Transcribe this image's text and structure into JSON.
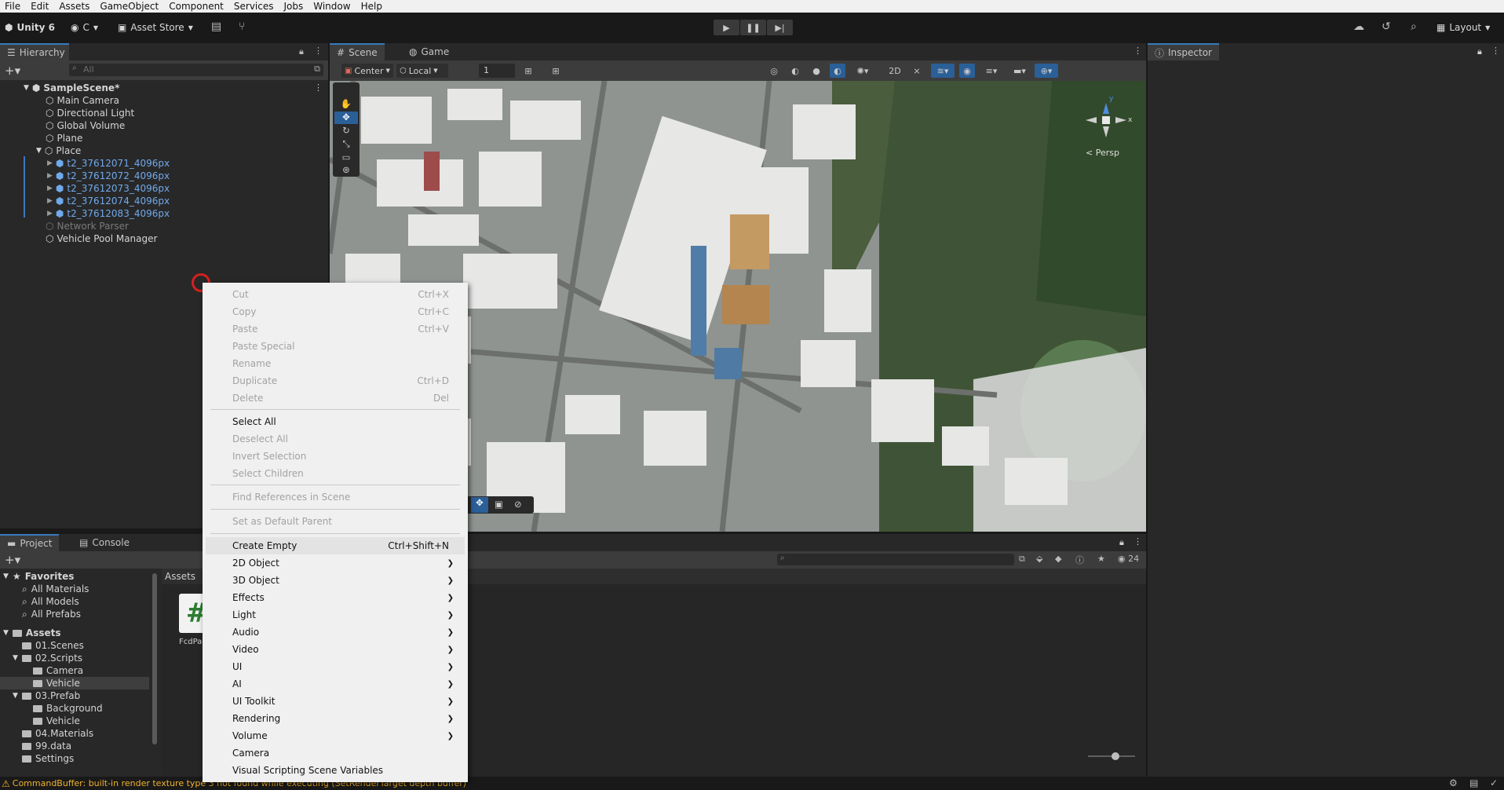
{
  "menubar": {
    "items": [
      "File",
      "Edit",
      "Assets",
      "GameObject",
      "Component",
      "Services",
      "Jobs",
      "Window",
      "Help"
    ]
  },
  "toolbar": {
    "unity": "Unity 6",
    "account": "C",
    "asset_store": "Asset Store",
    "layout": "Layout"
  },
  "hierarchy": {
    "tab": "Hierarchy",
    "search_placeholder": "All",
    "scene": "SampleScene*",
    "items": [
      "Main Camera",
      "Directional Light",
      "Global Volume",
      "Plane",
      "Place"
    ],
    "place_children": [
      "t2_37612071_4096px",
      "t2_37612072_4096px",
      "t2_37612073_4096px",
      "t2_37612074_4096px",
      "t2_37612083_4096px"
    ],
    "after": [
      "Network Parser",
      "Vehicle Pool Manager"
    ]
  },
  "scene": {
    "tabs": [
      "Scene",
      "Game"
    ],
    "pivot": "Center",
    "space": "Local",
    "snap": "1",
    "persp": "< Persp",
    "gizmo_x": "x",
    "gizmo_y": "y"
  },
  "inspector": {
    "tab": "Inspector"
  },
  "project": {
    "tabs": [
      "Project",
      "Console"
    ],
    "favorites": "Favorites",
    "fav_items": [
      "All Materials",
      "All Models",
      "All Prefabs"
    ],
    "assets": "Assets",
    "tree": [
      {
        "label": "01.Scenes",
        "indent": 1
      },
      {
        "label": "02.Scripts",
        "indent": 1
      },
      {
        "label": "Camera",
        "indent": 2
      },
      {
        "label": "Vehicle",
        "indent": 2
      },
      {
        "label": "03.Prefab",
        "indent": 1
      },
      {
        "label": "Background",
        "indent": 2
      },
      {
        "label": "Vehicle",
        "indent": 2
      },
      {
        "label": "04.Materials",
        "indent": 1
      },
      {
        "label": "99.data",
        "indent": 1
      },
      {
        "label": "Settings",
        "indent": 1
      }
    ],
    "breadcrumb": "Assets",
    "asset_name": "FcdPa",
    "count": "24"
  },
  "status": {
    "message": "CommandBuffer: built-in render texture type 3 not found while executing (SetRenderTarget depth buffer)"
  },
  "context_menu": {
    "group1": [
      {
        "label": "Cut",
        "shortcut": "Ctrl+X"
      },
      {
        "label": "Copy",
        "shortcut": "Ctrl+C"
      },
      {
        "label": "Paste",
        "shortcut": "Ctrl+V"
      },
      {
        "label": "Paste Special",
        "shortcut": ""
      },
      {
        "label": "Rename",
        "shortcut": ""
      },
      {
        "label": "Duplicate",
        "shortcut": "Ctrl+D"
      },
      {
        "label": "Delete",
        "shortcut": "Del"
      }
    ],
    "group2": [
      "Select All",
      "Deselect All",
      "Invert Selection",
      "Select Children"
    ],
    "find_refs": "Find References in Scene",
    "set_default": "Set as Default Parent",
    "create_empty": {
      "label": "Create Empty",
      "shortcut": "Ctrl+Shift+N"
    },
    "submenus": [
      "2D Object",
      "3D Object",
      "Effects",
      "Light",
      "Audio",
      "Video",
      "UI",
      "AI",
      "UI Toolkit",
      "Rendering",
      "Volume"
    ],
    "tail": [
      "Camera",
      "Visual Scripting Scene Variables"
    ]
  }
}
